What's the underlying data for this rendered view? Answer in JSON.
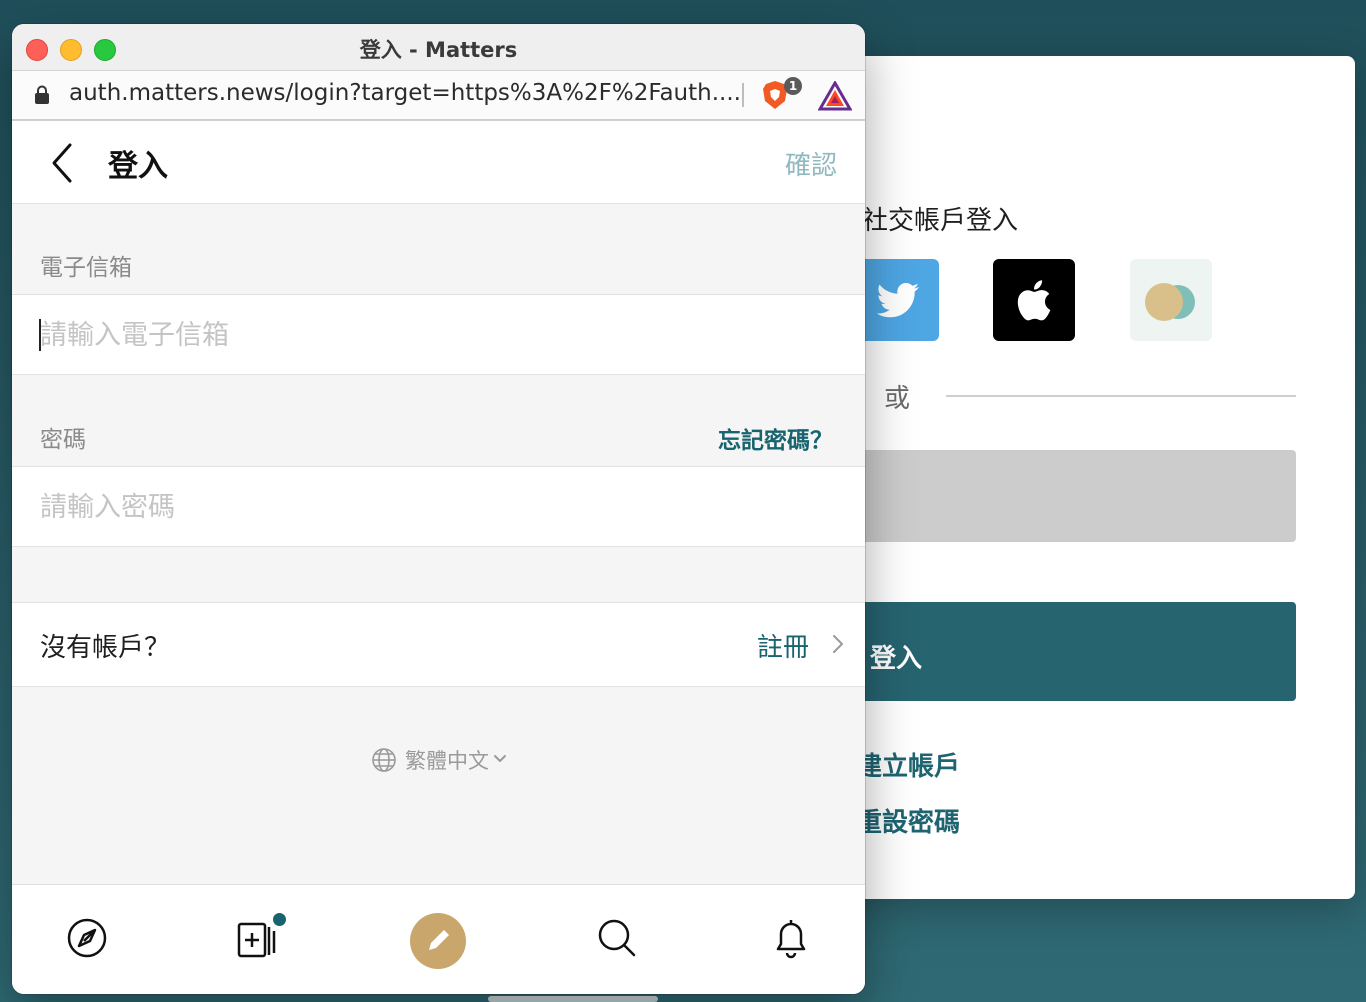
{
  "background_window": {
    "social_title": "社交帳戶登入",
    "social_buttons": [
      {
        "name": "twitter",
        "icon": "twitter-bird-icon",
        "color": "#4ea6e3"
      },
      {
        "name": "apple",
        "icon": "apple-logo-icon",
        "color": "#000000"
      },
      {
        "name": "wallet",
        "icon": "wallet-circles-icon",
        "color": "#edf4f1"
      }
    ],
    "or_label": "或",
    "login_label": "登入",
    "create_account_label": "建立帳戶",
    "reset_password_label": "重設密碼",
    "accent_color": "#266470"
  },
  "window": {
    "title": "登入 - Matters",
    "url": "auth.matters.news/login?target=https%3A%2F%2Fauth....",
    "brave_badge_count": "1"
  },
  "header": {
    "title": "登入",
    "confirm_label": "確認"
  },
  "email": {
    "label": "電子信箱",
    "placeholder": "請輸入電子信箱",
    "value": ""
  },
  "password": {
    "label": "密碼",
    "placeholder": "請輸入密碼",
    "forgot_label": "忘記密碼？",
    "value": ""
  },
  "signup": {
    "question": "沒有帳戶？",
    "link_label": "註冊"
  },
  "language": {
    "selected": "繁體中文"
  },
  "bottom_nav": [
    {
      "name": "discover",
      "icon": "compass-icon"
    },
    {
      "name": "follow",
      "icon": "follow-feed-icon",
      "has_unread": true
    },
    {
      "name": "write",
      "icon": "pencil-icon"
    },
    {
      "name": "search",
      "icon": "search-icon"
    },
    {
      "name": "notifications",
      "icon": "bell-icon"
    }
  ],
  "colors": {
    "brand_teal": "#17646f",
    "confirm_disabled": "#8fb8bf",
    "write_button": "#c9a76c"
  }
}
